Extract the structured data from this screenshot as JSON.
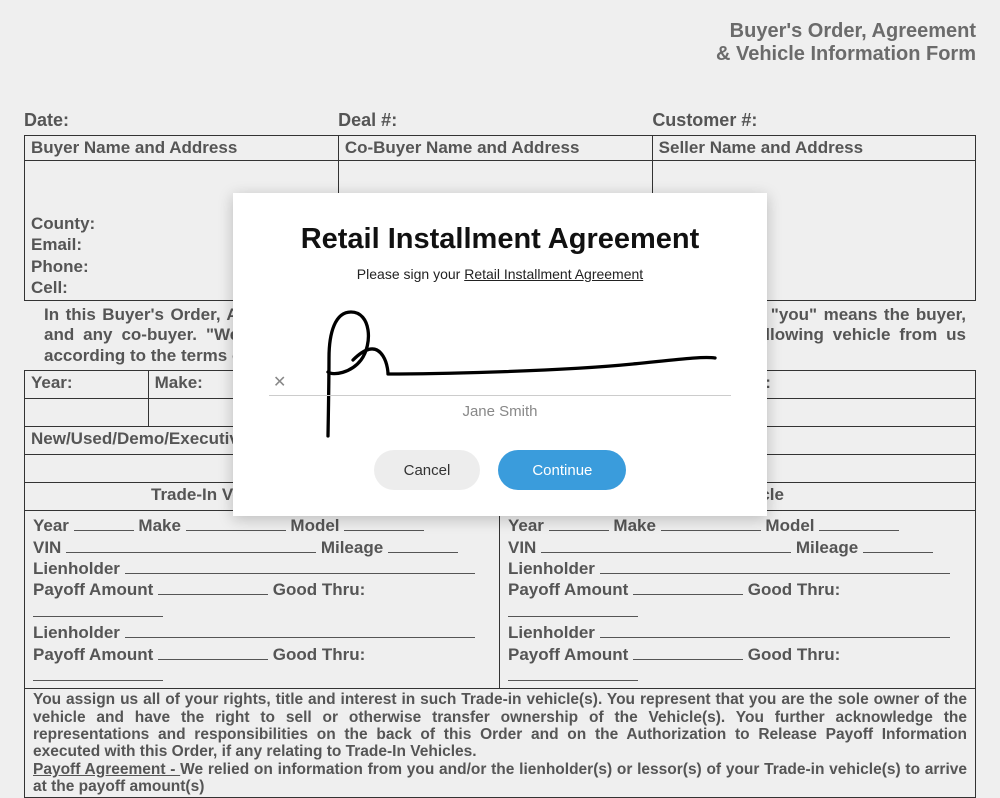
{
  "form": {
    "header_line1": "Buyer's Order, Agreement",
    "header_line2": "& Vehicle Information Form",
    "date_label": "Date:",
    "deal_label": "Deal #:",
    "customer_label": "Customer #:",
    "buyer_hdr": "Buyer Name and Address",
    "cobuyer_hdr": "Co-Buyer Name and Address",
    "seller_hdr": "Seller Name and Address",
    "county_label": "County:",
    "email_label": "Email:",
    "phone_label": "Phone:",
    "cell_label": "Cell:",
    "intro_text": "In this Buyer's Order, Agreement & Vehicle Information Form (\"Order and Agreement\"), \"you\" means the buyer, and any co-buyer.  \"We,\" \"us,\" and \"our\" means the seller. You agree to buy the following vehicle from us according to the terms of this Order and Agreement.",
    "year_label": "Year:",
    "make_label": "Make:",
    "er_label": "er:",
    "newused_label": "New/Used/Demo/Executive",
    "tradein_left_hdr": "Trade-In Vehicle",
    "tradein_right_hdr": "hicle",
    "ti_year": "Year",
    "ti_make": "Make",
    "ti_model": "Model",
    "ti_vin": "VIN",
    "ti_mileage": "Mileage",
    "ti_lienholder": "Lienholder",
    "ti_payoff": "Payoff Amount",
    "ti_goodthru": "Good Thru:",
    "disclaimer_1": "You assign us all of your rights, title and interest in such Trade-in vehicle(s).  You represent that you are the sole owner of the vehicle and have the right to sell or otherwise transfer ownership of the Vehicle(s). You further acknowledge the representations and responsibilities on the back of this Order and on the Authorization to Release Payoff Information executed with this Order, if any relating to Trade-In Vehicles.",
    "disclaimer_2a": "Payoff Agreement - ",
    "disclaimer_2b": "We relied on information from you and/or the lienholder(s) or lessor(s) of your Trade-in vehicle(s) to arrive at the payoff amount(s)"
  },
  "modal": {
    "title": "Retail Installment Agreement",
    "subtext_prefix": "Please sign your ",
    "subtext_link": "Retail Installment Agreement",
    "sign_x": "✕",
    "signer_name": "Jane Smith",
    "cancel_label": "Cancel",
    "continue_label": "Continue"
  }
}
